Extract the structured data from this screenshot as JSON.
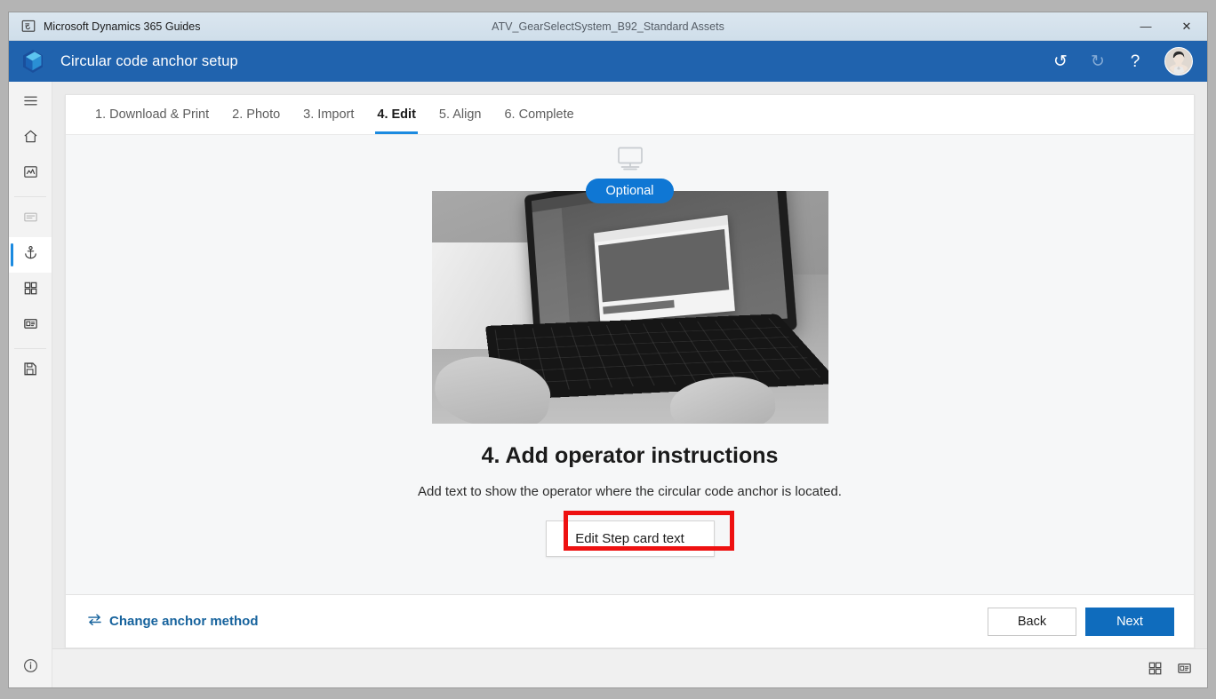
{
  "titlebar": {
    "app_name": "Microsoft Dynamics 365 Guides",
    "document_title": "ATV_GearSelectSystem_B92_Standard Assets",
    "app_icon": "guides-app-icon",
    "minimize_label": "—",
    "close_label": "✕"
  },
  "header": {
    "title": "Circular code anchor setup",
    "logo_icon": "dynamics-guides-logo",
    "undo": {
      "icon": "undo-icon",
      "glyph": "↺",
      "enabled": true
    },
    "redo": {
      "icon": "redo-icon",
      "glyph": "↻",
      "enabled": false
    },
    "help": {
      "icon": "help-icon",
      "glyph": "?"
    },
    "avatar": {
      "icon": "user-avatar",
      "alt": "User account"
    },
    "accent_color": "#2063ae"
  },
  "sidebar": {
    "items": [
      {
        "name": "menu",
        "icon": "hamburger-menu-icon",
        "state": "normal"
      },
      {
        "name": "home",
        "icon": "home-icon",
        "state": "normal"
      },
      {
        "name": "analytics",
        "icon": "analytics-icon",
        "state": "normal"
      },
      {
        "name": "outline",
        "icon": "outline-icon",
        "state": "disabled"
      },
      {
        "name": "anchor",
        "icon": "anchor-icon",
        "state": "active"
      },
      {
        "name": "steps-grid",
        "icon": "grid-icon",
        "state": "normal"
      },
      {
        "name": "media-card",
        "icon": "card-icon",
        "state": "normal"
      },
      {
        "name": "save",
        "icon": "save-icon",
        "state": "normal"
      }
    ],
    "bottom": {
      "name": "info",
      "icon": "info-circle-icon"
    },
    "active_indicator_color": "#1b8ae0"
  },
  "tabs": [
    {
      "label": "1. Download & Print",
      "active": false
    },
    {
      "label": "2. Photo",
      "active": false
    },
    {
      "label": "3. Import",
      "active": false
    },
    {
      "label": "4. Edit",
      "active": true
    },
    {
      "label": "5. Align",
      "active": false
    },
    {
      "label": "6. Complete",
      "active": false
    }
  ],
  "stage": {
    "monitor_icon": "pc-monitor-icon",
    "optional_badge": "Optional",
    "optional_badge_color": "#0f77d4",
    "photo_alt": "Hands typing on a laptop showing the Guides PC app",
    "title": "4. Add operator instructions",
    "description": "Add text to show the operator where the circular code anchor is located.",
    "edit_button": "Edit Step card text",
    "annotation_color": "#ee1111"
  },
  "footer": {
    "change_anchor_link": "Change anchor method",
    "change_anchor_icon": "swap-arrows-icon",
    "back_button": "Back",
    "next_button": "Next",
    "link_color": "#17639d",
    "primary_color": "#0f6cbd"
  },
  "statusbar": {
    "icons": [
      {
        "name": "grid-view",
        "icon": "grid-view-icon"
      },
      {
        "name": "card-view",
        "icon": "card-view-icon"
      }
    ]
  }
}
